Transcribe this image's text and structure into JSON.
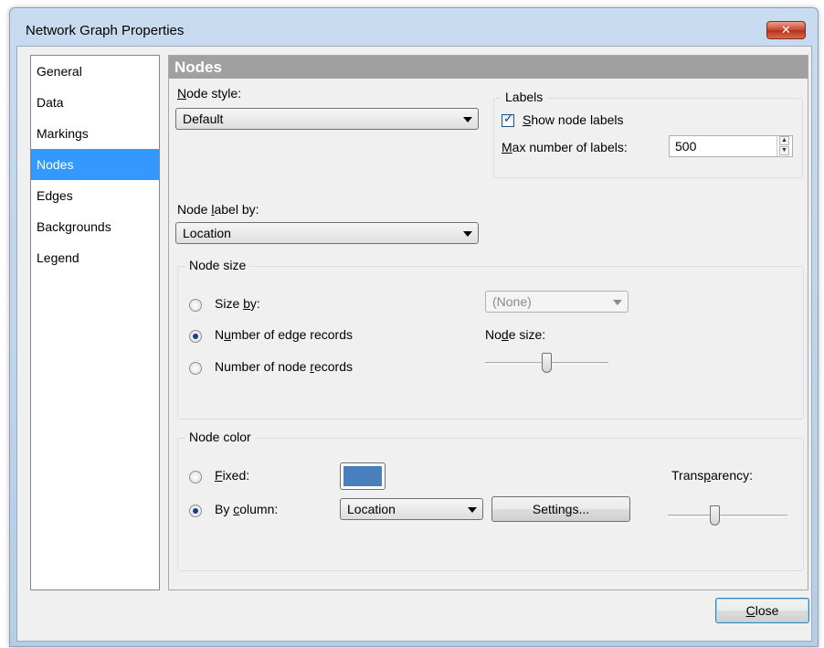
{
  "window": {
    "title": "Network Graph Properties",
    "close_glyph": "✕"
  },
  "nav": {
    "items": [
      {
        "label": "General"
      },
      {
        "label": "Data"
      },
      {
        "label": "Markings"
      },
      {
        "label": "Nodes"
      },
      {
        "label": "Edges"
      },
      {
        "label": "Backgrounds"
      },
      {
        "label": "Legend"
      }
    ],
    "selected": "Nodes"
  },
  "panel": {
    "header": "Nodes",
    "node_style": {
      "label_pre": "",
      "label_ul": "N",
      "label_post": "ode style:",
      "value": "Default"
    },
    "labels_group": {
      "title": "Labels",
      "show_labels": {
        "ul": "S",
        "rest": "how node labels",
        "checked": true
      },
      "max_labels": {
        "ul": "M",
        "rest": "ax number of labels:",
        "value": "500"
      }
    },
    "node_label_by": {
      "pre": "Node ",
      "ul": "l",
      "post": "abel by:",
      "value": "Location"
    },
    "node_size_group": {
      "title": "Node size",
      "size_by": {
        "pre": "Size ",
        "ul": "b",
        "post": "y:",
        "selected": false
      },
      "size_by_value": "(None)",
      "edge_records": {
        "pre": "N",
        "ul": "u",
        "post": "mber of edge records",
        "selected": true
      },
      "node_records": {
        "pre": "Number of node ",
        "ul": "r",
        "post": "ecords",
        "selected": false
      },
      "slider_label": {
        "pre": "No",
        "ul": "d",
        "post": "e size:"
      },
      "slider_value": 0.5
    },
    "node_color_group": {
      "title": "Node color",
      "fixed": {
        "pre": "",
        "ul": "F",
        "post": "ixed:",
        "selected": false
      },
      "fixed_color": "#4a7fbe",
      "by_column": {
        "pre": "By ",
        "ul": "c",
        "post": "olumn:",
        "selected": true
      },
      "by_column_value": "Location",
      "settings_label": "Settings...",
      "transparency_label": {
        "pre": "Trans",
        "ul": "p",
        "post": "arency:"
      },
      "transparency_value": 0.4
    }
  },
  "footer": {
    "close": {
      "ul": "C",
      "rest": "lose"
    }
  }
}
